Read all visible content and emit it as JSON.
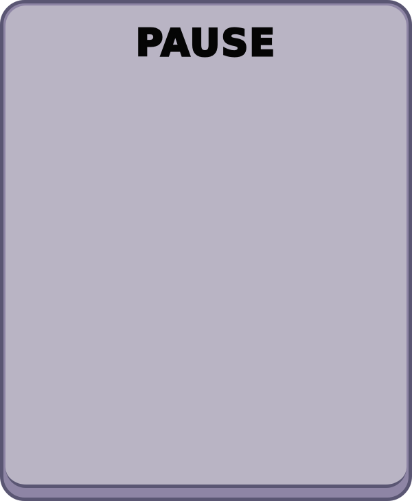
{
  "pause_menu": {
    "title": "PAUSE"
  },
  "colors": {
    "panel_face": "#b9b4c4",
    "panel_border": "#5a5673",
    "panel_shadow": "#8e85a5",
    "title_text": "#050505"
  }
}
